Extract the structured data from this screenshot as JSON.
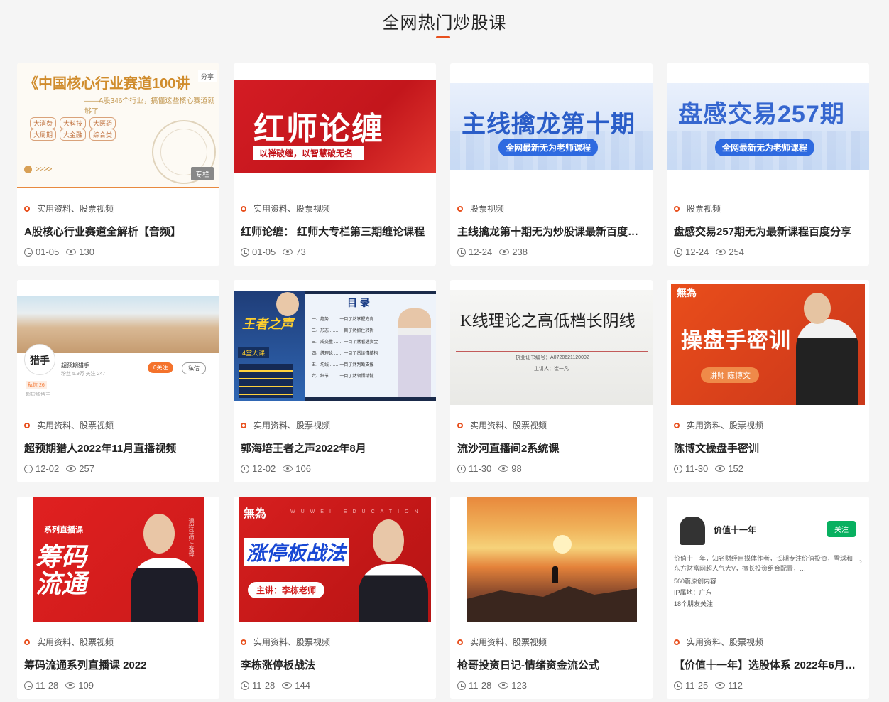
{
  "section": {
    "title": "全网热门炒股课"
  },
  "courses": [
    {
      "category": "实用资料、股票视频",
      "title": "A股核心行业赛道全解析【音频】",
      "date": "01-05",
      "views": "130",
      "thumb": {
        "big": "《中国核心行业赛道100讲",
        "sub": "——A股346个行业，搞懂这些核心赛道就够了",
        "tags": [
          "大消费",
          "大科技",
          "大医药",
          "大周期",
          "大金融",
          "综合类"
        ],
        "arrows": ">>>>",
        "badge": "专栏",
        "share": "分享"
      }
    },
    {
      "category": "实用资料、股票视频",
      "title": "红师论缠： 红师大专栏第三期缠论课程",
      "date": "01-05",
      "views": "73",
      "thumb": {
        "big": "红师论缠",
        "band": "以禅破缠，以智慧破无名"
      }
    },
    {
      "category": "股票视频",
      "title": "主线擒龙第十期无为炒股课最新百度网盘分享",
      "date": "12-24",
      "views": "238",
      "thumb": {
        "big": "主线擒龙第十期",
        "pill": "全网最新无为老师课程"
      }
    },
    {
      "category": "股票视频",
      "title": "盘感交易257期无为最新课程百度分享",
      "date": "12-24",
      "views": "254",
      "thumb": {
        "big": "盘感交易257期",
        "pill": "全网最新无为老师课程"
      }
    },
    {
      "category": "实用资料、股票视频",
      "title": "超预期猎人2022年11月直播视频",
      "date": "12-02",
      "views": "257",
      "thumb": {
        "avatar": "猎手",
        "name": "超预期猎手",
        "fans": "粉丝 5.9万  关注 247",
        "btn1": "0关注",
        "btn2": "私信",
        "lv": "私信 26",
        "desc": "超短线博主"
      }
    },
    {
      "category": "实用资料、股票视频",
      "title": "郭海培王者之声2022年8月",
      "date": "12-02",
      "views": "106",
      "thumb": {
        "wz": "王者之声",
        "ru": "4堂大课",
        "ml": "目 录",
        "rows": [
          "一、趋势 …… 一目了然掌握方向",
          "二、形态 …… 一目了然抓住转折",
          "三、成交量 …… 一目了然看透资金",
          "四、缠理论 …… 一目了然读懂结构",
          "五、均线 …… 一目了然判断支撑",
          "六、细节 …… 一目了然领悟精髓"
        ]
      }
    },
    {
      "category": "实用资料、股票视频",
      "title": "流沙河直播间2系统课",
      "date": "11-30",
      "views": "98",
      "thumb": {
        "big": "K线理论之高低档长阴线",
        "s1": "执业证书编号：A0720621120002",
        "s2": "主讲人：崔一凡"
      }
    },
    {
      "category": "实用资料、股票视频",
      "title": "陈博文操盘手密训",
      "date": "11-30",
      "views": "152",
      "thumb": {
        "logo": "無為",
        "big": "操盘手密训",
        "pill": "讲师 陈博文"
      }
    },
    {
      "category": "实用资料、股票视频",
      "title": "筹码流通系列直播课 2022",
      "date": "11-28",
      "views": "109",
      "thumb": {
        "tag": "系列直播课",
        "big": "筹码流通",
        "vert": "课程导师 / 赛博"
      }
    },
    {
      "category": "实用资料、股票视频",
      "title": "李栋涨停板战法",
      "date": "11-28",
      "views": "144",
      "thumb": {
        "logo": "無為",
        "ww": "WUWEI EDUCATION",
        "big": "涨停板战法",
        "pill": "主讲：李栋老师"
      }
    },
    {
      "category": "实用资料、股票视频",
      "title": "枪哥投资日记-情绪资金流公式",
      "date": "11-28",
      "views": "123",
      "thumb": {}
    },
    {
      "category": "实用资料、股票视频",
      "title": "【价值十一年】选股体系 2022年6月更新",
      "date": "11-25",
      "views": "112",
      "thumb": {
        "name": "价值十一年",
        "follow": "关注",
        "desc": "价值十一年，知名财经自媒体作者，长期专注价值投资，雪球和东方财富网超人气大V，擅长投资组合配置，…",
        "l1": "560篇原创内容",
        "l2": "IP属地：广东",
        "l3": "18个朋友关注",
        "chev": "›"
      }
    }
  ],
  "colors": {
    "accent": "#e8501e",
    "background": "#f5f5f5",
    "card": "#ffffff"
  }
}
